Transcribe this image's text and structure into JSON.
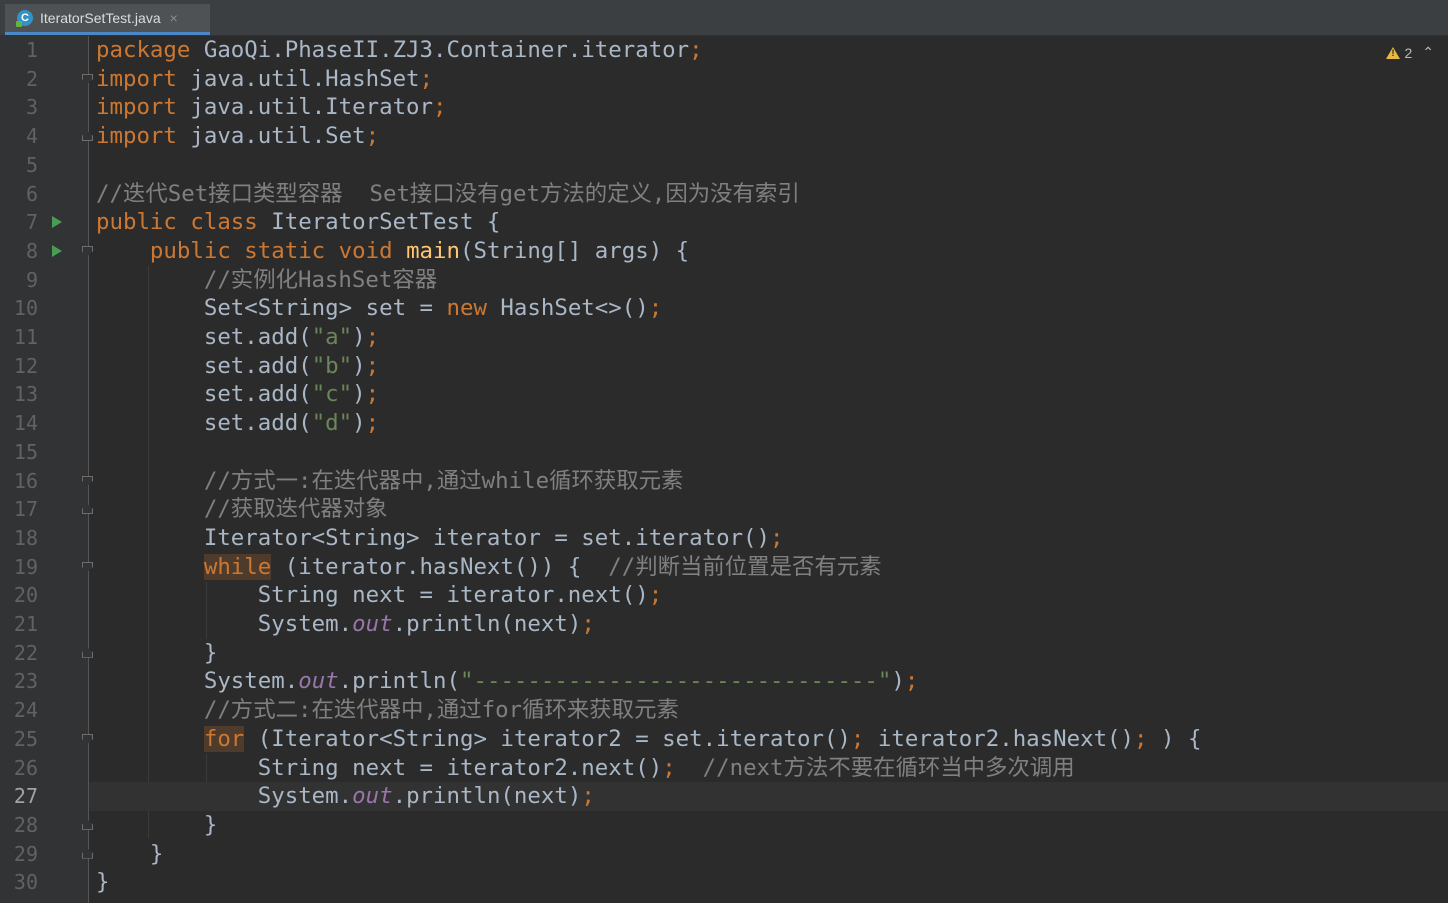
{
  "tab": {
    "label": "IteratorSetTest.java",
    "close": "×"
  },
  "inspections": {
    "warning_count": "2"
  },
  "current_line": 27,
  "lines": [
    {
      "n": "1",
      "parts": [
        [
          "k",
          "package "
        ],
        [
          "p",
          "GaoQi.PhaseII.ZJ3.Container.iterator"
        ],
        [
          "k",
          ";"
        ]
      ]
    },
    {
      "n": "2",
      "fold": "open",
      "parts": [
        [
          "k",
          "import "
        ],
        [
          "p",
          "java.util.HashSet"
        ],
        [
          "k",
          ";"
        ]
      ]
    },
    {
      "n": "3",
      "parts": [
        [
          "k",
          "import "
        ],
        [
          "p",
          "java.util.Iterator"
        ],
        [
          "k",
          ";"
        ]
      ]
    },
    {
      "n": "4",
      "fold": "close",
      "parts": [
        [
          "k",
          "import "
        ],
        [
          "p",
          "java.util.Set"
        ],
        [
          "k",
          ";"
        ]
      ]
    },
    {
      "n": "5",
      "parts": []
    },
    {
      "n": "6",
      "parts": [
        [
          "c",
          "//迭代Set接口类型容器  Set接口没有get方法的定义,因为没有索引"
        ]
      ]
    },
    {
      "n": "7",
      "run": true,
      "parts": [
        [
          "k",
          "public class "
        ],
        [
          "p",
          "IteratorSetTest {"
        ]
      ]
    },
    {
      "n": "8",
      "run": true,
      "fold": "open",
      "parts": [
        [
          "p",
          "    "
        ],
        [
          "k",
          "public static void "
        ],
        [
          "f",
          "main"
        ],
        [
          "p",
          "(String[] args) {"
        ]
      ]
    },
    {
      "n": "9",
      "parts": [
        [
          "p",
          "        "
        ],
        [
          "c",
          "//实例化HashSet容器"
        ]
      ]
    },
    {
      "n": "10",
      "parts": [
        [
          "p",
          "        Set<String> set = "
        ],
        [
          "k",
          "new "
        ],
        [
          "p",
          "HashSet<>()"
        ],
        [
          "k",
          ";"
        ]
      ]
    },
    {
      "n": "11",
      "parts": [
        [
          "p",
          "        set.add("
        ],
        [
          "s",
          "\"a\""
        ],
        [
          "p",
          ")"
        ],
        [
          "k",
          ";"
        ]
      ]
    },
    {
      "n": "12",
      "parts": [
        [
          "p",
          "        set.add("
        ],
        [
          "s",
          "\"b\""
        ],
        [
          "p",
          ")"
        ],
        [
          "k",
          ";"
        ]
      ]
    },
    {
      "n": "13",
      "parts": [
        [
          "p",
          "        set.add("
        ],
        [
          "s",
          "\"c\""
        ],
        [
          "p",
          ")"
        ],
        [
          "k",
          ";"
        ]
      ]
    },
    {
      "n": "14",
      "parts": [
        [
          "p",
          "        set.add("
        ],
        [
          "s",
          "\"d\""
        ],
        [
          "p",
          ")"
        ],
        [
          "k",
          ";"
        ]
      ]
    },
    {
      "n": "15",
      "parts": []
    },
    {
      "n": "16",
      "fold": "open",
      "parts": [
        [
          "p",
          "        "
        ],
        [
          "c",
          "//方式一:在迭代器中,通过while循环获取元素"
        ]
      ]
    },
    {
      "n": "17",
      "fold": "close",
      "parts": [
        [
          "p",
          "        "
        ],
        [
          "c",
          "//获取迭代器对象"
        ]
      ]
    },
    {
      "n": "18",
      "parts": [
        [
          "p",
          "        Iterator<String> iterator = set.iterator()"
        ],
        [
          "k",
          ";"
        ]
      ]
    },
    {
      "n": "19",
      "fold": "open",
      "parts": [
        [
          "p",
          "        "
        ],
        [
          "kh",
          "while"
        ],
        [
          "p",
          " (iterator.hasNext()) {  "
        ],
        [
          "c",
          "//判断当前位置是否有元素"
        ]
      ]
    },
    {
      "n": "20",
      "parts": [
        [
          "p",
          "            String next = iterator.next()"
        ],
        [
          "k",
          ";"
        ]
      ]
    },
    {
      "n": "21",
      "parts": [
        [
          "p",
          "            System."
        ],
        [
          "st",
          "out"
        ],
        [
          "p",
          ".println(next)"
        ],
        [
          "k",
          ";"
        ]
      ]
    },
    {
      "n": "22",
      "fold": "close",
      "parts": [
        [
          "p",
          "        }"
        ]
      ]
    },
    {
      "n": "23",
      "parts": [
        [
          "p",
          "        System."
        ],
        [
          "st",
          "out"
        ],
        [
          "p",
          ".println("
        ],
        [
          "s",
          "\"------------------------------\""
        ],
        [
          "p",
          ")"
        ],
        [
          "k",
          ";"
        ]
      ]
    },
    {
      "n": "24",
      "parts": [
        [
          "p",
          "        "
        ],
        [
          "c",
          "//方式二:在迭代器中,通过for循环来获取元素"
        ]
      ]
    },
    {
      "n": "25",
      "fold": "open",
      "parts": [
        [
          "p",
          "        "
        ],
        [
          "kh",
          "for"
        ],
        [
          "p",
          " (Iterator<String> iterator2 = set.iterator()"
        ],
        [
          "k",
          "; "
        ],
        [
          "p",
          "iterator2.hasNext()"
        ],
        [
          "k",
          "; "
        ],
        [
          "p",
          ") {"
        ]
      ]
    },
    {
      "n": "26",
      "parts": [
        [
          "p",
          "            String next = iterator2.next()"
        ],
        [
          "k",
          ";  "
        ],
        [
          "c",
          "//next方法不要在循环当中多次调用"
        ]
      ]
    },
    {
      "n": "27",
      "parts": [
        [
          "p",
          "            System."
        ],
        [
          "st",
          "out"
        ],
        [
          "p",
          ".println(next)"
        ],
        [
          "k",
          ";"
        ]
      ]
    },
    {
      "n": "28",
      "fold": "close",
      "parts": [
        [
          "p",
          "        }"
        ]
      ]
    },
    {
      "n": "29",
      "fold": "close",
      "parts": [
        [
          "p",
          "    }"
        ]
      ]
    },
    {
      "n": "30",
      "parts": [
        [
          "p",
          "}"
        ]
      ]
    }
  ]
}
